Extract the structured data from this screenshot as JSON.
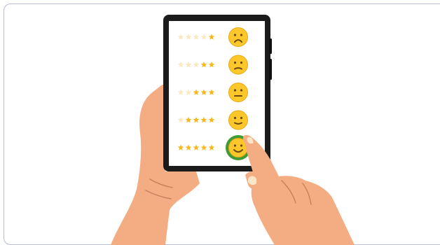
{
  "rating": {
    "rows": [
      {
        "stars": 1,
        "mood": "very-sad-face-icon",
        "selected": false
      },
      {
        "stars": 2,
        "mood": "sad-face-icon",
        "selected": false
      },
      {
        "stars": 3,
        "mood": "neutral-face-icon",
        "selected": false
      },
      {
        "stars": 4,
        "mood": "slight-smile-face-icon",
        "selected": false
      },
      {
        "stars": 5,
        "mood": "happy-face-icon",
        "selected": true
      }
    ],
    "max_stars": 5
  },
  "colors": {
    "star_filled": "#f6b91e",
    "star_empty": "#fbe8bf",
    "face": "#fcc72a",
    "selection_ring": "#3f9c35",
    "phone_body": "#1b1b1b",
    "skin": "#f4ad83",
    "frame_border": "#b9bcd6"
  }
}
